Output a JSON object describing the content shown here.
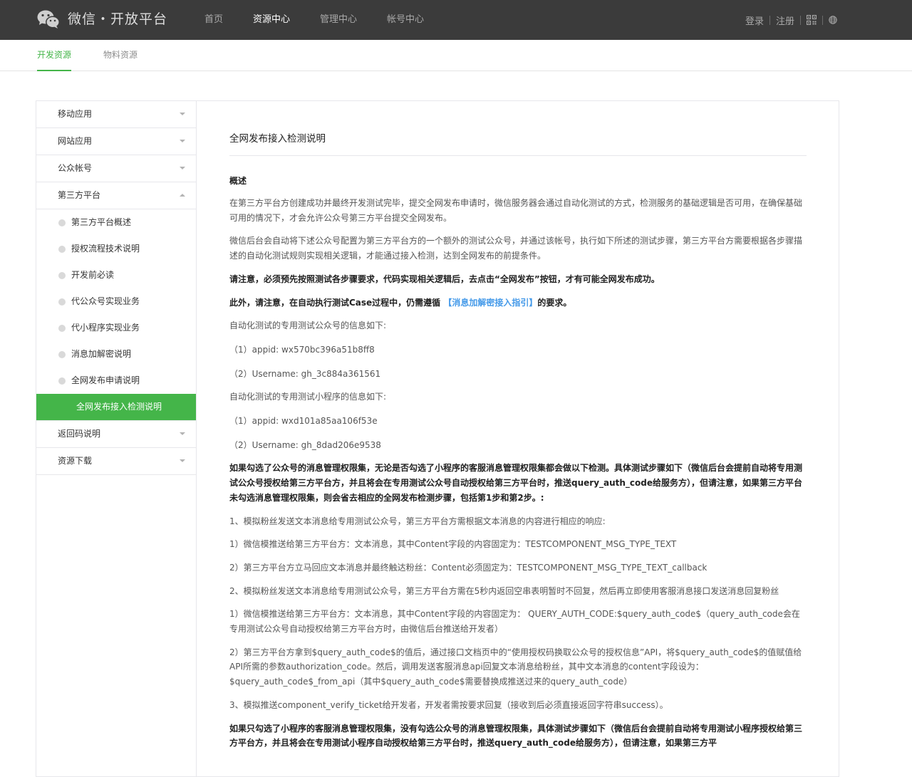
{
  "header": {
    "logo_text": "微信・开放平台",
    "nav": [
      "首页",
      "资源中心",
      "管理中心",
      "帐号中心"
    ],
    "active_nav": "资源中心",
    "login": "登录",
    "register": "注册"
  },
  "subnav": {
    "tabs": [
      "开发资源",
      "物料资源"
    ]
  },
  "sidebar": {
    "items": [
      {
        "label": "移动应用"
      },
      {
        "label": "网站应用"
      },
      {
        "label": "公众帐号"
      },
      {
        "label": "第三方平台"
      }
    ],
    "sub_items": [
      {
        "label": "第三方平台概述"
      },
      {
        "label": "授权流程技术说明"
      },
      {
        "label": "开发前必读"
      },
      {
        "label": "代公众号实现业务"
      },
      {
        "label": "代小程序实现业务"
      },
      {
        "label": "消息加解密说明"
      },
      {
        "label": "全网发布申请说明"
      },
      {
        "label": "全网发布接入检测说明"
      }
    ],
    "items_after": [
      {
        "label": "返回码说明"
      },
      {
        "label": "资源下载"
      }
    ]
  },
  "content": {
    "title": "全网发布接入检测说明",
    "section": "概述",
    "p1": "在第三方平台方创建成功并最终开发测试完毕，提交全网发布申请时，微信服务器会通过自动化测试的方式，检测服务的基础逻辑是否可用，在确保基础可用的情况下，才会允许公众号第三方平台提交全网发布。",
    "p2": "微信后台会自动将下述公众号配置为第三方平台方的一个额外的测试公众号，并通过该帐号，执行如下所述的测试步骤，第三方平台方需要根据各步骤描述的自动化测试规则实现相关逻辑，才能通过接入检测，达到全网发布的前提条件。",
    "p3": "请注意，必须预先按照测试各步骤要求，代码实现相关逻辑后，去点击“全网发布”按钮，才有可能全网发布成功。",
    "p4_pre": "此外，请注意，在自动执行测试Case过程中，仍需遵循 ",
    "p4_link": "【消息加解密接入指引】",
    "p4_post": "的要求。",
    "p5": "自动化测试的专用测试公众号的信息如下:",
    "p6": "（1）appid:   wx570bc396a51b8ff8",
    "p7": "（2）Username:   gh_3c884a361561",
    "p8": "自动化测试的专用测试小程序的信息如下:",
    "p9": "（1）appid:   wxd101a85aa106f53e",
    "p10": "（2）Username:   gh_8dad206e9538",
    "p11": "如果勾选了公众号的消息管理权限集，无论是否勾选了小程序的客服消息管理权限集都会做以下检测。具体测试步骤如下（微信后台会提前自动将专用测试公众号授权给第三方平台方，并且将会在专用测试公众号自动授权给第三方平台时，推送query_auth_code给服务方），但请注意，如果第三方平台未勾选消息管理权限集，则会省去相应的全网发布检测步骤，包括第1步和第2步。:",
    "p12": "1、模拟粉丝发送文本消息给专用测试公众号，第三方平台方需根据文本消息的内容进行相应的响应:",
    "p13": "1）微信模推送给第三方平台方：文本消息，其中Content字段的内容固定为：TESTCOMPONENT_MSG_TYPE_TEXT",
    "p14": "2）第三方平台方立马回应文本消息并最终触达粉丝：Content必须固定为：TESTCOMPONENT_MSG_TYPE_TEXT_callback",
    "p15": "2、模拟粉丝发送文本消息给专用测试公众号，第三方平台方需在5秒内返回空串表明暂时不回复，然后再立即使用客服消息接口发送消息回复粉丝",
    "p16": "1）微信模推送给第三方平台方：文本消息，其中Content字段的内容固定为： QUERY_AUTH_CODE:$query_auth_code$（query_auth_code会在专用测试公众号自动授权给第三方平台方时，由微信后台推送给开发者）",
    "p17": "2）第三方平台方拿到$query_auth_code$的值后，通过接口文档页中的“使用授权码换取公众号的授权信息”API，将$query_auth_code$的值赋值给API所需的参数authorization_code。然后，调用发送客服消息api回复文本消息给粉丝，其中文本消息的content字段设为：$query_auth_code$_from_api（其中$query_auth_code$需要替换成推送过来的query_auth_code）",
    "p18": "3、模拟推送component_verify_ticket给开发者，开发者需按要求回复（接收到后必须直接返回字符串success）。",
    "p19": "如果只勾选了小程序的客服消息管理权限集，没有勾选公众号的消息管理权限集，具体测试步骤如下（微信后台会提前自动将专用测试小程序授权给第三方平台方，并且将会在专用测试小程序自动授权给第三方平台时，推送query_auth_code给服务方），但请注意，如果第三方平"
  }
}
